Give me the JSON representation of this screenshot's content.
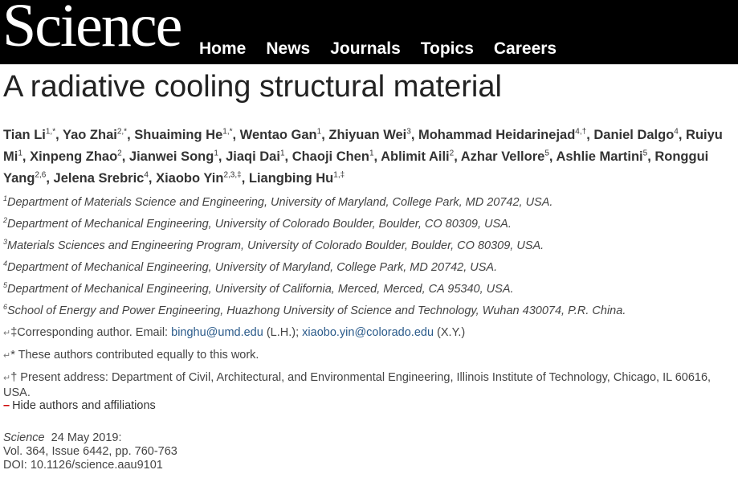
{
  "header": {
    "logo": "Science",
    "nav": [
      "Home",
      "News",
      "Journals",
      "Topics",
      "Careers"
    ]
  },
  "article": {
    "title": "A radiative cooling structural material",
    "authors": [
      {
        "name": "Tian Li",
        "sup": "1,*"
      },
      {
        "name": "Yao Zhai",
        "sup": "2,*"
      },
      {
        "name": "Shuaiming He",
        "sup": "1,*"
      },
      {
        "name": "Wentao Gan",
        "sup": "1"
      },
      {
        "name": "Zhiyuan Wei",
        "sup": "3"
      },
      {
        "name": "Mohammad Heidarinejad",
        "sup": "4,†"
      },
      {
        "name": "Daniel Dalgo",
        "sup": "4"
      },
      {
        "name": "Ruiyu Mi",
        "sup": "1"
      },
      {
        "name": "Xinpeng Zhao",
        "sup": "2"
      },
      {
        "name": "Jianwei Song",
        "sup": "1"
      },
      {
        "name": "Jiaqi Dai",
        "sup": "1"
      },
      {
        "name": "Chaoji Chen",
        "sup": "1"
      },
      {
        "name": "Ablimit Aili",
        "sup": "2"
      },
      {
        "name": "Azhar Vellore",
        "sup": "5"
      },
      {
        "name": "Ashlie Martini",
        "sup": "5"
      },
      {
        "name": "Ronggui Yang",
        "sup": "2,6"
      },
      {
        "name": "Jelena Srebric",
        "sup": "4"
      },
      {
        "name": "Xiaobo Yin",
        "sup": "2,3,‡"
      },
      {
        "name": "Liangbing Hu",
        "sup": "1,‡"
      }
    ],
    "affiliations": [
      {
        "num": "1",
        "text": "Department of Materials Science and Engineering, University of Maryland, College Park, MD 20742, USA."
      },
      {
        "num": "2",
        "text": "Department of Mechanical Engineering, University of Colorado Boulder, Boulder, CO 80309, USA."
      },
      {
        "num": "3",
        "text": "Materials Sciences and Engineering Program, University of Colorado Boulder, Boulder, CO 80309, USA."
      },
      {
        "num": "4",
        "text": "Department of Mechanical Engineering, University of Maryland, College Park, MD 20742, USA."
      },
      {
        "num": "5",
        "text": "Department of Mechanical Engineering, University of California, Merced, Merced, CA 95340, USA."
      },
      {
        "num": "6",
        "text": "School of Energy and Power Engineering, Huazhong University of Science and Technology, Wuhan 430074, P.R. China."
      }
    ],
    "notes": {
      "corresponding_prefix": "‡Corresponding author. Email: ",
      "email1": "binghu@umd.edu",
      "mid": " (L.H.); ",
      "email2": "xiaobo.yin@colorado.edu",
      "suffix": " (X.Y.)",
      "equal": "* These authors contributed equally to this work.",
      "present": "† Present address: Department of Civil, Architectural, and Environmental Engineering, Illinois Institute of Technology, Chicago, IL 60616, USA."
    },
    "hide_toggle": "Hide authors and affiliations",
    "citation": {
      "journal": "Science",
      "date": "24 May 2019:",
      "volume": "Vol. 364, Issue 6442, pp. 760-763",
      "doi": "DOI: 10.1126/science.aau9101"
    }
  }
}
